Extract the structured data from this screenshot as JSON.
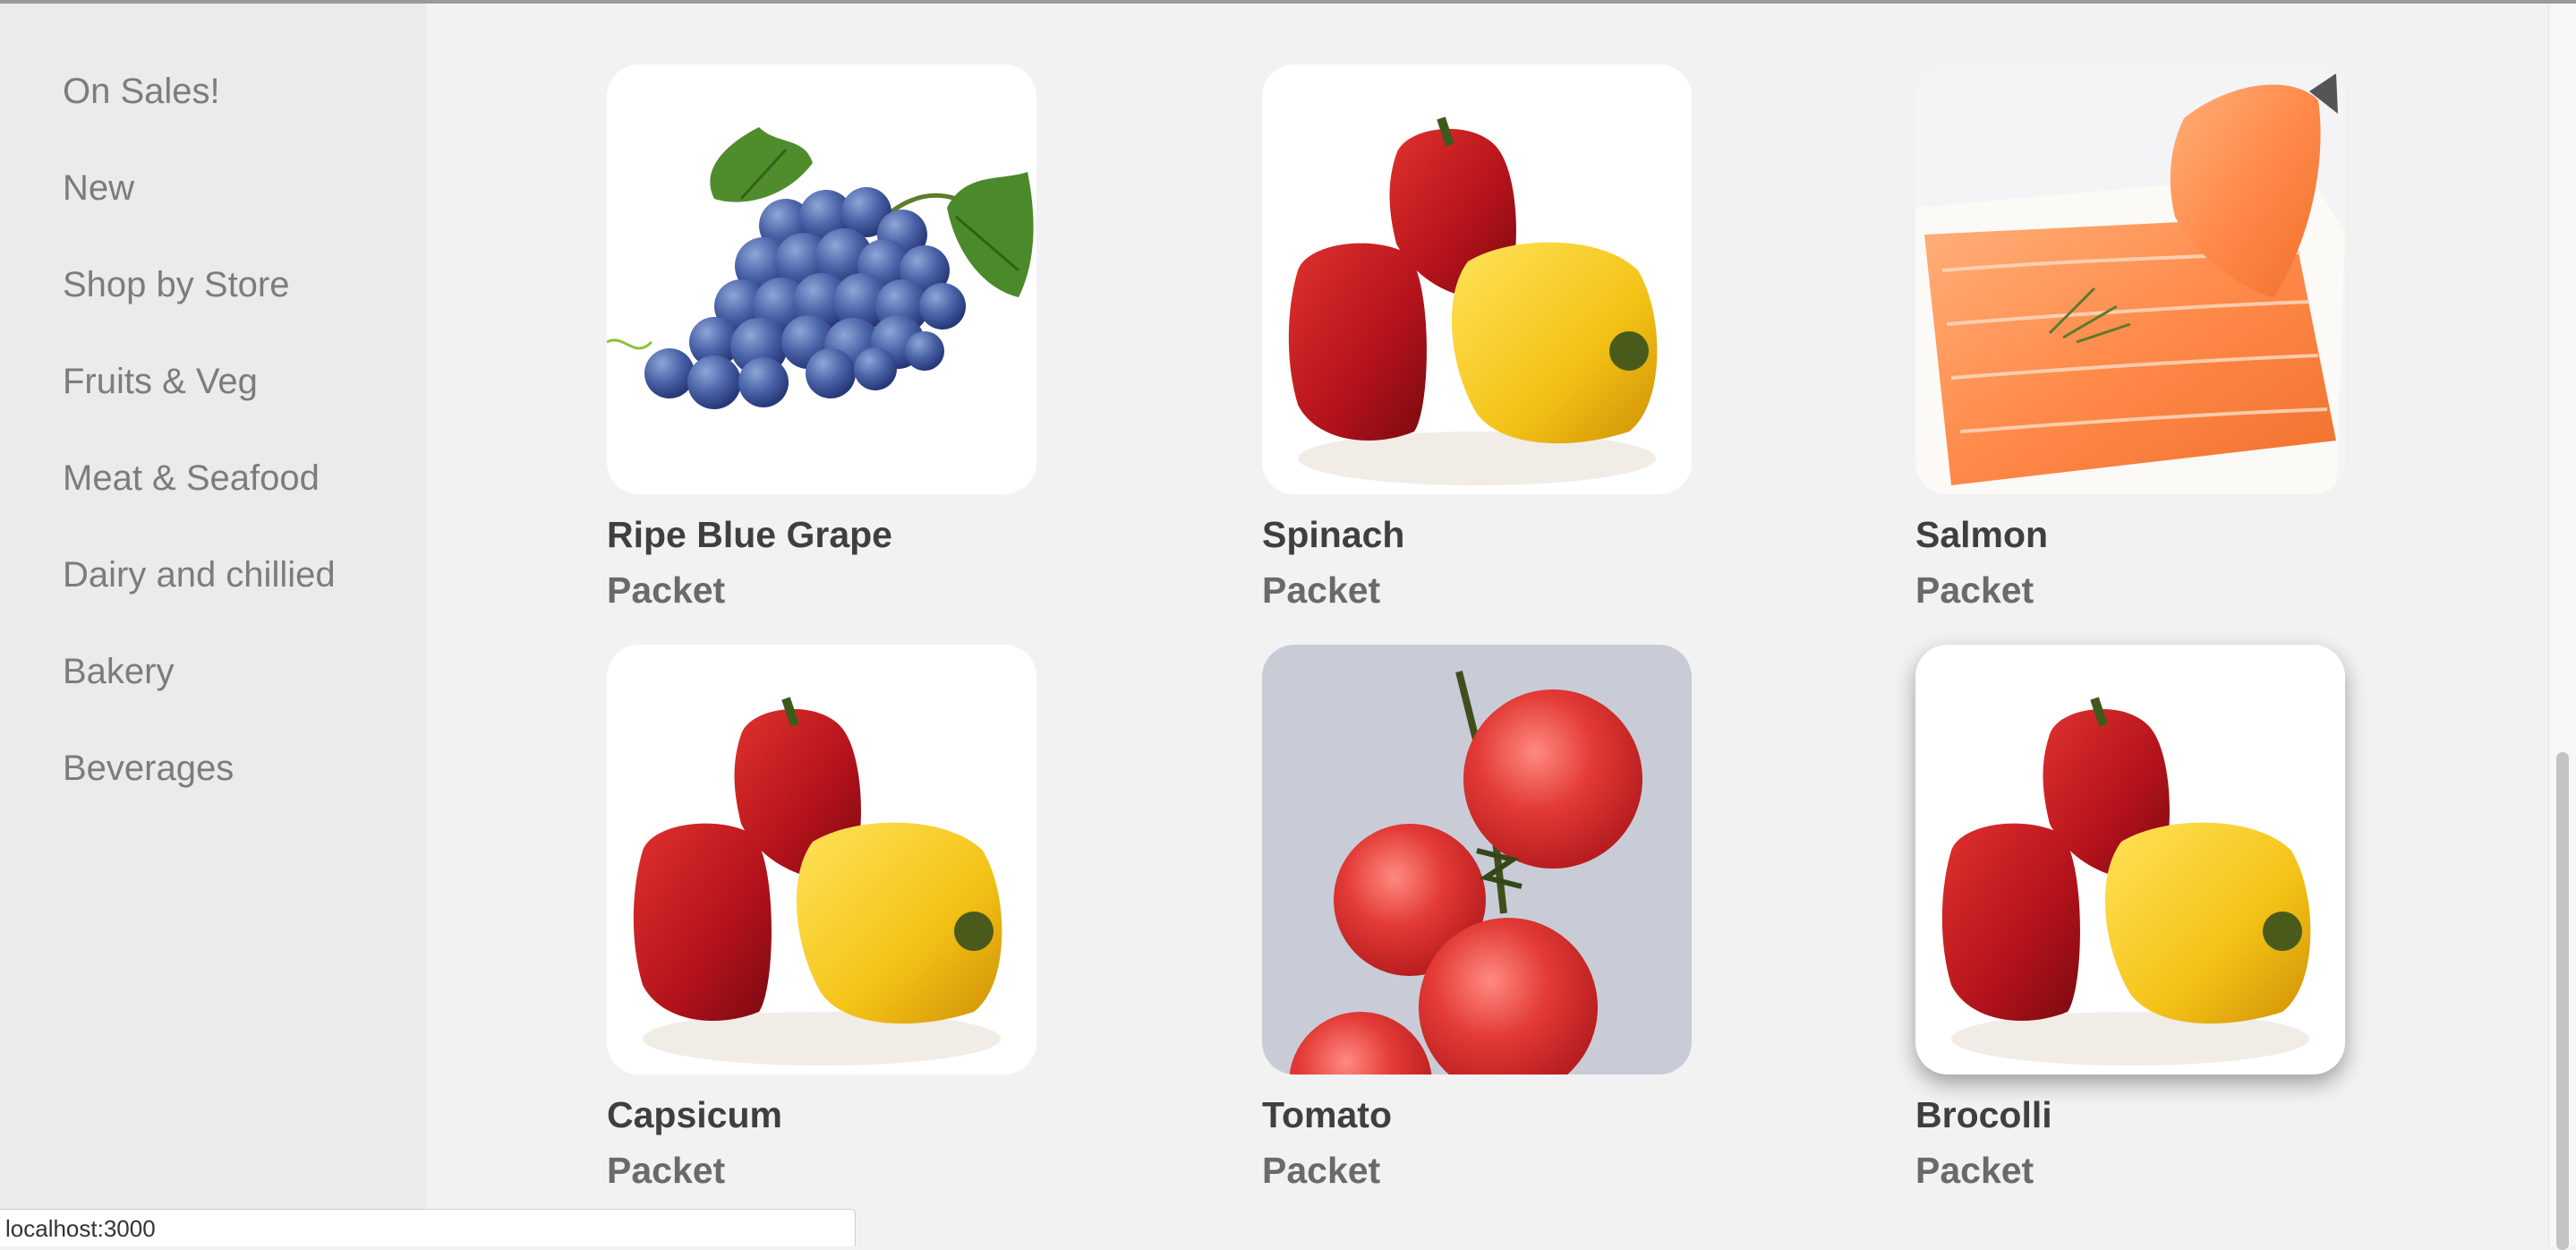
{
  "sidebar": {
    "items": [
      {
        "label": "On Sales!"
      },
      {
        "label": "New"
      },
      {
        "label": "Shop by Store"
      },
      {
        "label": "Fruits & Veg"
      },
      {
        "label": "Meat & Seafood"
      },
      {
        "label": "Dairy and chillied"
      },
      {
        "label": "Bakery"
      },
      {
        "label": "Beverages"
      }
    ]
  },
  "products": [
    {
      "name": "Ripe Blue Grape",
      "unit": "Packet",
      "image": "grapes-image"
    },
    {
      "name": "Spinach",
      "unit": "Packet",
      "image": "peppers-image"
    },
    {
      "name": "Salmon",
      "unit": "Packet",
      "image": "salmon-image"
    },
    {
      "name": "Capsicum",
      "unit": "Packet",
      "image": "peppers-image"
    },
    {
      "name": "Tomato",
      "unit": "Packet",
      "image": "tomato-image"
    },
    {
      "name": "Brocolli",
      "unit": "Packet",
      "image": "peppers-image"
    }
  ],
  "status_bar": {
    "url": "localhost:3000"
  },
  "colors": {
    "page_bg": "#f2f2f2",
    "sidebar_bg": "#e9ebec",
    "sidebar_text": "#7c7c7c",
    "product_name": "#3f3f3f",
    "product_unit": "#6a6a6a"
  }
}
